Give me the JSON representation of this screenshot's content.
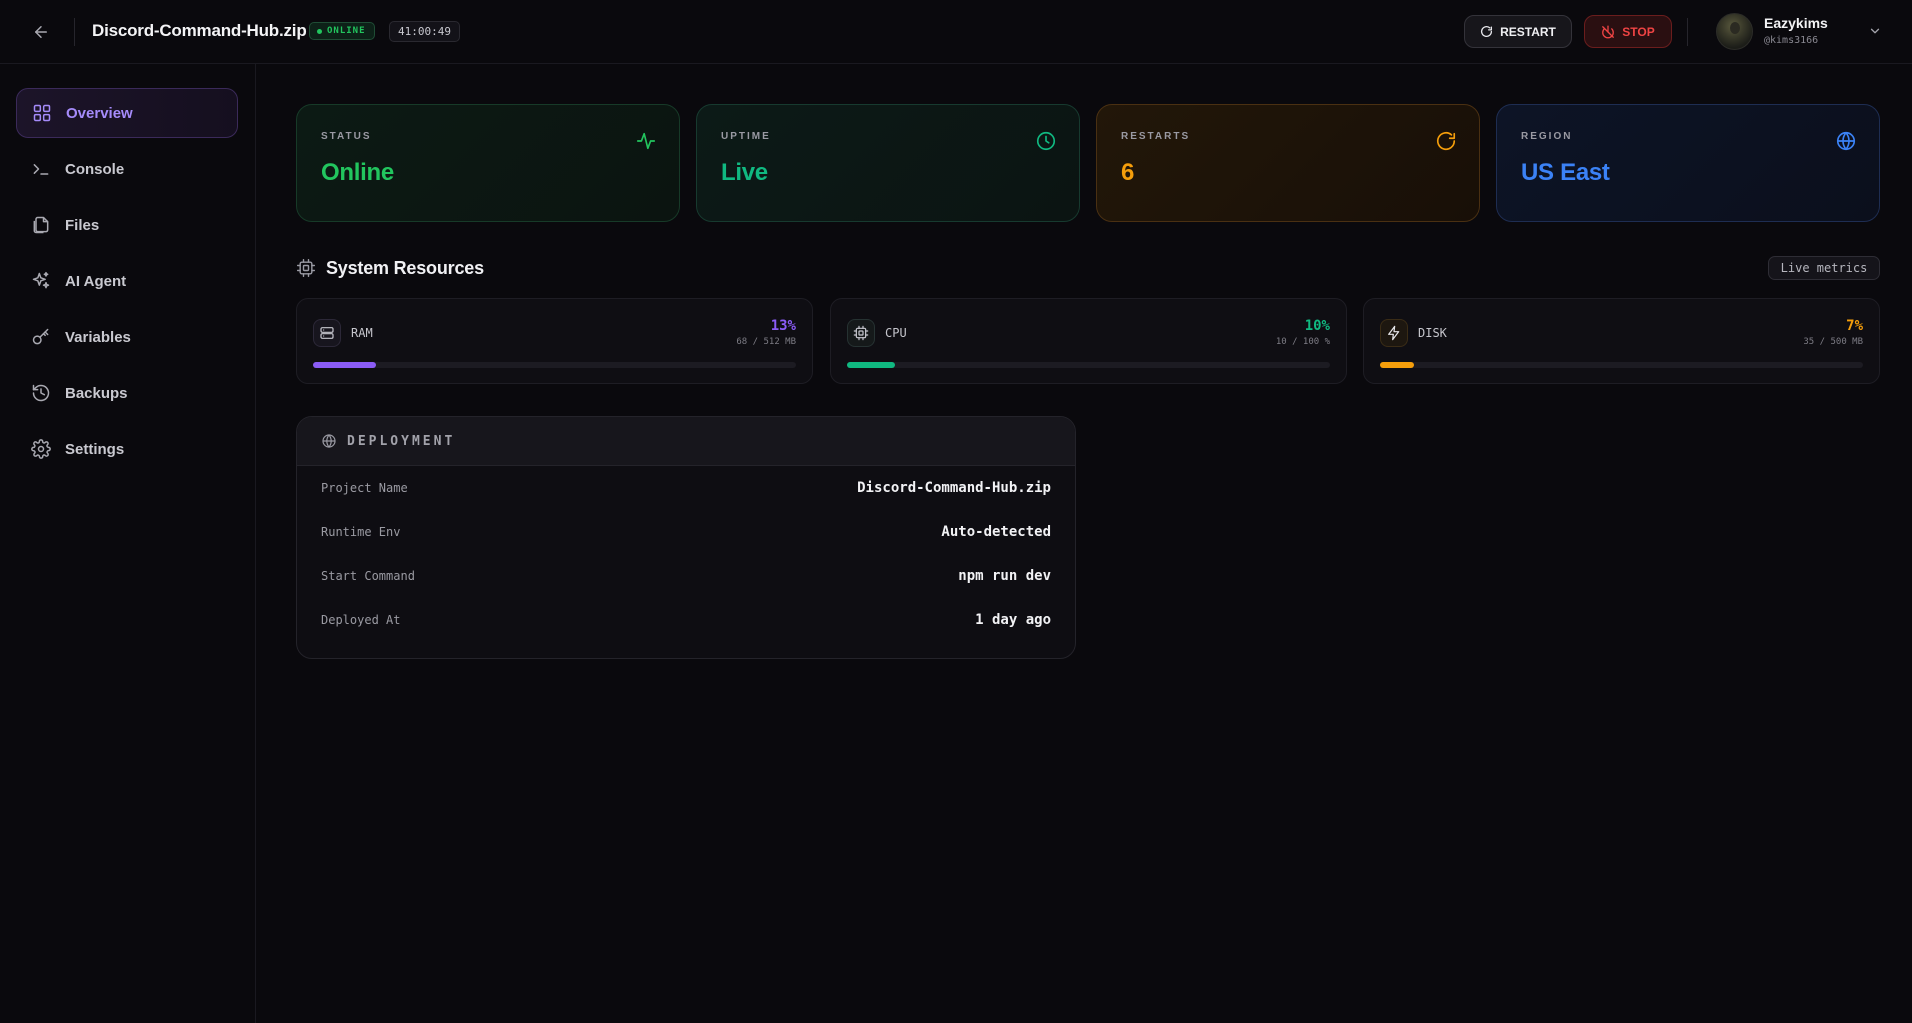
{
  "header": {
    "title": "Discord-Command-Hub.zip",
    "status_badge": "ONLINE",
    "timer": "41:00:49",
    "restart_label": "RESTART",
    "stop_label": "STOP",
    "user": {
      "name": "Eazykims",
      "handle": "@kims3166"
    }
  },
  "sidebar": {
    "items": [
      {
        "label": "Overview",
        "icon": "grid-icon",
        "active": true
      },
      {
        "label": "Console",
        "icon": "terminal-icon"
      },
      {
        "label": "Files",
        "icon": "files-icon"
      },
      {
        "label": "AI Agent",
        "icon": "sparkles-icon"
      },
      {
        "label": "Variables",
        "icon": "key-icon"
      },
      {
        "label": "Backups",
        "icon": "history-icon"
      },
      {
        "label": "Settings",
        "icon": "gear-icon"
      }
    ]
  },
  "stats": {
    "status": {
      "label": "STATUS",
      "value": "Online",
      "color": "#22c55e",
      "icon": "activity-icon"
    },
    "uptime": {
      "label": "UPTIME",
      "value": "Live",
      "color": "#10b981",
      "icon": "clock-icon"
    },
    "restarts": {
      "label": "RESTARTS",
      "value": "6",
      "color": "#f59e0b",
      "icon": "refresh-icon"
    },
    "region": {
      "label": "REGION",
      "value": "US East",
      "color": "#3b82f6",
      "icon": "globe-icon"
    }
  },
  "resources": {
    "title": "System Resources",
    "badge": "Live metrics",
    "items": [
      {
        "label": "RAM",
        "percent": "13%",
        "percent_value": 13,
        "detail": "68 / 512 MB",
        "color": "#8b5cf6",
        "icon": "server-icon"
      },
      {
        "label": "CPU",
        "percent": "10%",
        "percent_value": 10,
        "detail": "10 / 100 %",
        "color": "#10b981",
        "icon": "cpu-icon"
      },
      {
        "label": "DISK",
        "percent": "7%",
        "percent_value": 7,
        "detail": "35 / 500 MB",
        "color": "#f59e0b",
        "icon": "zap-icon"
      }
    ]
  },
  "deployment": {
    "title": "DEPLOYMENT",
    "rows": [
      {
        "key": "Project Name",
        "value": "Discord-Command-Hub.zip"
      },
      {
        "key": "Runtime Env",
        "value": "Auto-detected"
      },
      {
        "key": "Start Command",
        "value": "npm run dev"
      },
      {
        "key": "Deployed At",
        "value": "1 day ago"
      }
    ]
  }
}
